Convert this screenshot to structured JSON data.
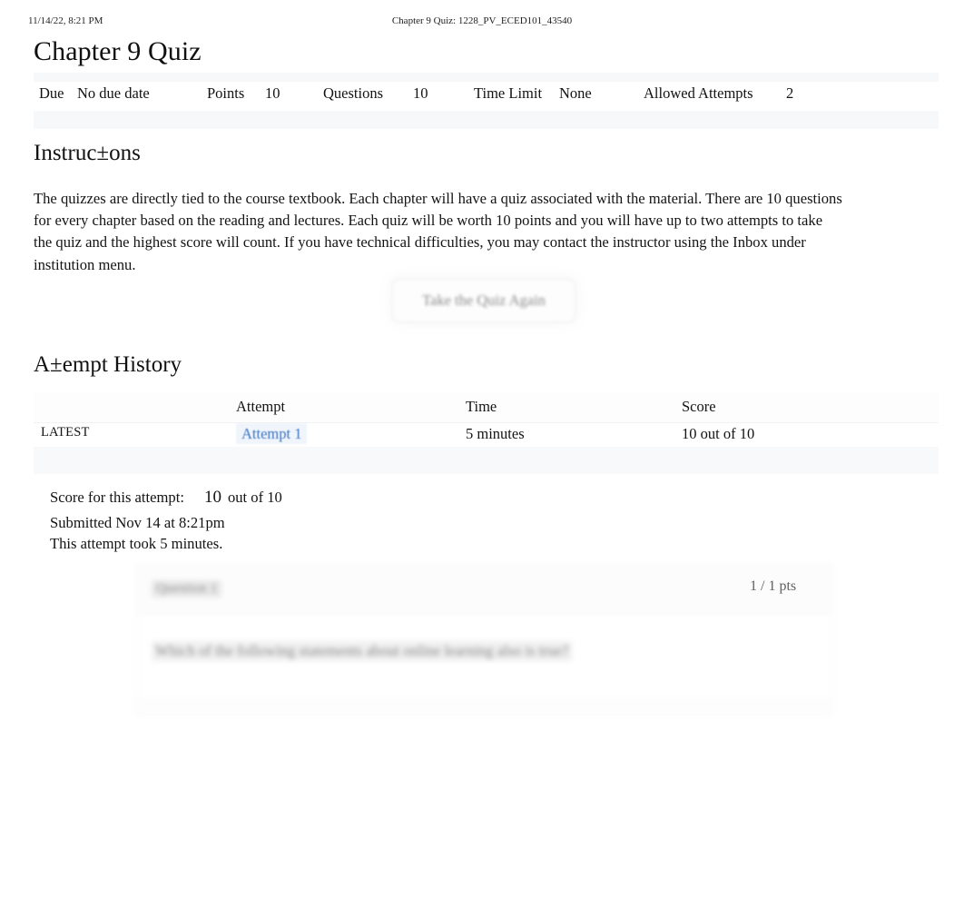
{
  "print_header": {
    "left": "11/14/22, 8:21 PM",
    "center": "Chapter 9 Quiz: 1228_PV_ECED101_43540"
  },
  "page_title": "Chapter 9 Quiz",
  "meta": {
    "due_label": "Due",
    "due_value": "No due date",
    "points_label": "Points",
    "points_value": "10",
    "questions_label": "Questions",
    "questions_value": "10",
    "time_limit_label": "Time Limit",
    "time_limit_value": "None",
    "allowed_attempts_label": "Allowed Attempts",
    "allowed_attempts_value": "2"
  },
  "instructions": {
    "heading": "Instruc±ons",
    "body": "The quizzes are directly tied to the course textbook. Each chapter will have a quiz associated with the material. There are 10 questions for every chapter based on the reading and lectures. Each quiz will be worth 10 points and you will have up to two attempts to take the quiz and the highest score will count. If you have technical difficulties, you may contact the instructor using the Inbox under institution menu."
  },
  "take_quiz_button": "Take the Quiz Again",
  "attempt_history": {
    "heading": "A±empt History",
    "columns": [
      "",
      "Attempt",
      "Time",
      "Score"
    ],
    "rows": [
      {
        "flag": "LATEST",
        "attempt": "Attempt 1",
        "time": "5 minutes",
        "score": "10 out of 10"
      }
    ]
  },
  "score_summary": {
    "label": "Score for this attempt:",
    "score": "10",
    "out_of": "out of 10",
    "submitted": "Submitted Nov 14 at 8:21pm",
    "duration": "This attempt took 5 minutes."
  },
  "question_card": {
    "label": "Question 1",
    "points": "1 / 1 pts",
    "text": "Which of the following statements about online learning also is true?"
  },
  "colors": {
    "link": "#3b73c4",
    "text": "#131313",
    "band": "#f7f8f9",
    "muted": "#666666"
  }
}
